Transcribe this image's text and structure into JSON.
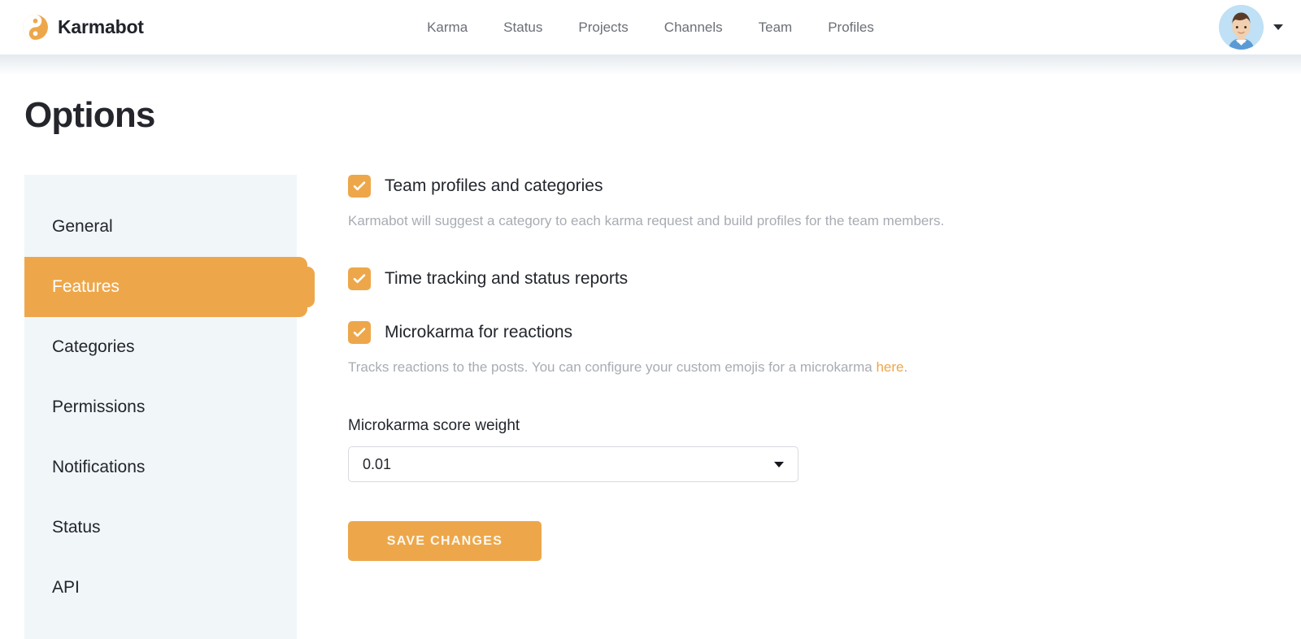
{
  "brand": {
    "name": "Karmabot",
    "logo_icon": "yinyang-icon",
    "accent_color": "#eda74a"
  },
  "nav": {
    "items": [
      {
        "label": "Karma"
      },
      {
        "label": "Status"
      },
      {
        "label": "Projects"
      },
      {
        "label": "Channels"
      },
      {
        "label": "Team"
      },
      {
        "label": "Profiles"
      }
    ]
  },
  "user_menu": {
    "avatar_icon": "user-avatar",
    "caret_icon": "chevron-down-icon"
  },
  "page": {
    "title": "Options"
  },
  "sidebar": {
    "items": [
      {
        "label": "General",
        "active": false
      },
      {
        "label": "Features",
        "active": true
      },
      {
        "label": "Categories",
        "active": false
      },
      {
        "label": "Permissions",
        "active": false
      },
      {
        "label": "Notifications",
        "active": false
      },
      {
        "label": "Status",
        "active": false
      },
      {
        "label": "API",
        "active": false
      }
    ]
  },
  "features": {
    "options": [
      {
        "label": "Team profiles and categories",
        "checked": true,
        "helper": "Karmabot will suggest a category to each karma request and build profiles for the team members."
      },
      {
        "label": "Time tracking and status reports",
        "checked": true,
        "helper": ""
      },
      {
        "label": "Microkarma for reactions",
        "checked": true,
        "helper_before": "Tracks reactions to the posts. You can configure your custom emojis for a microkarma ",
        "helper_link": "here",
        "helper_after": "."
      }
    ],
    "weight_field": {
      "label": "Microkarma score weight",
      "value": "0.01",
      "caret_icon": "caret-down-icon"
    },
    "save_label": "SAVE CHANGES"
  }
}
